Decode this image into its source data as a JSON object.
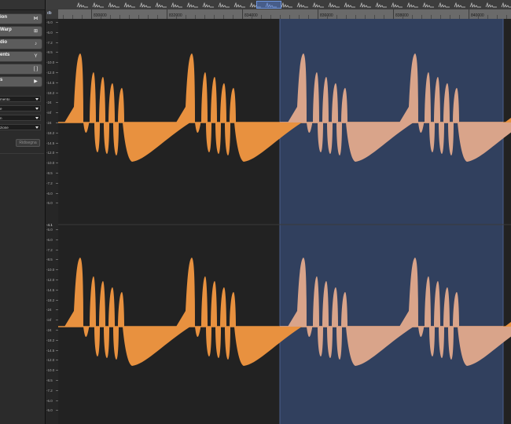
{
  "inspector": {
    "buttons": [
      {
        "label": "ion",
        "icon": "beat-markers-icon",
        "glyph": "⋈"
      },
      {
        "label": "Warp",
        "icon": "warp-icon",
        "glyph": "⊞"
      },
      {
        "label": "dio",
        "icon": "audio-file-icon",
        "glyph": "♪"
      },
      {
        "label": "ents",
        "icon": "funnel-icon",
        "glyph": "Y"
      },
      {
        "label": "",
        "icon": "bracket-icon",
        "glyph": "[ ]"
      },
      {
        "label": "s",
        "icon": "play-circle-icon",
        "glyph": "▶"
      }
    ],
    "dropdowns": [
      {
        "label": "mento"
      },
      {
        "label": "e"
      },
      {
        "label": "n"
      },
      {
        "label": "zione"
      }
    ],
    "redraw_label": "Ridisegna"
  },
  "db_ruler": {
    "unit": "db",
    "labels": [
      "-5.0",
      "-6.0",
      "-7.2",
      "-8.5",
      "-10.0",
      "-12.0",
      "-14.5",
      "-18.2",
      "-24",
      "-inf",
      "-24",
      "-18.2",
      "-14.5",
      "-12.0",
      "-10.0",
      "-8.5",
      "-7.2",
      "-6.0",
      "-5.0"
    ],
    "channel_divider_label": "-4.1"
  },
  "timeline": {
    "labels": [
      "830000",
      "832000",
      "834000",
      "836000",
      "838000",
      "840000"
    ]
  },
  "colors": {
    "waveform": "#e8913f",
    "waveform_selected": "#d9a48a",
    "selection": "#31405e",
    "background": "#222222"
  }
}
